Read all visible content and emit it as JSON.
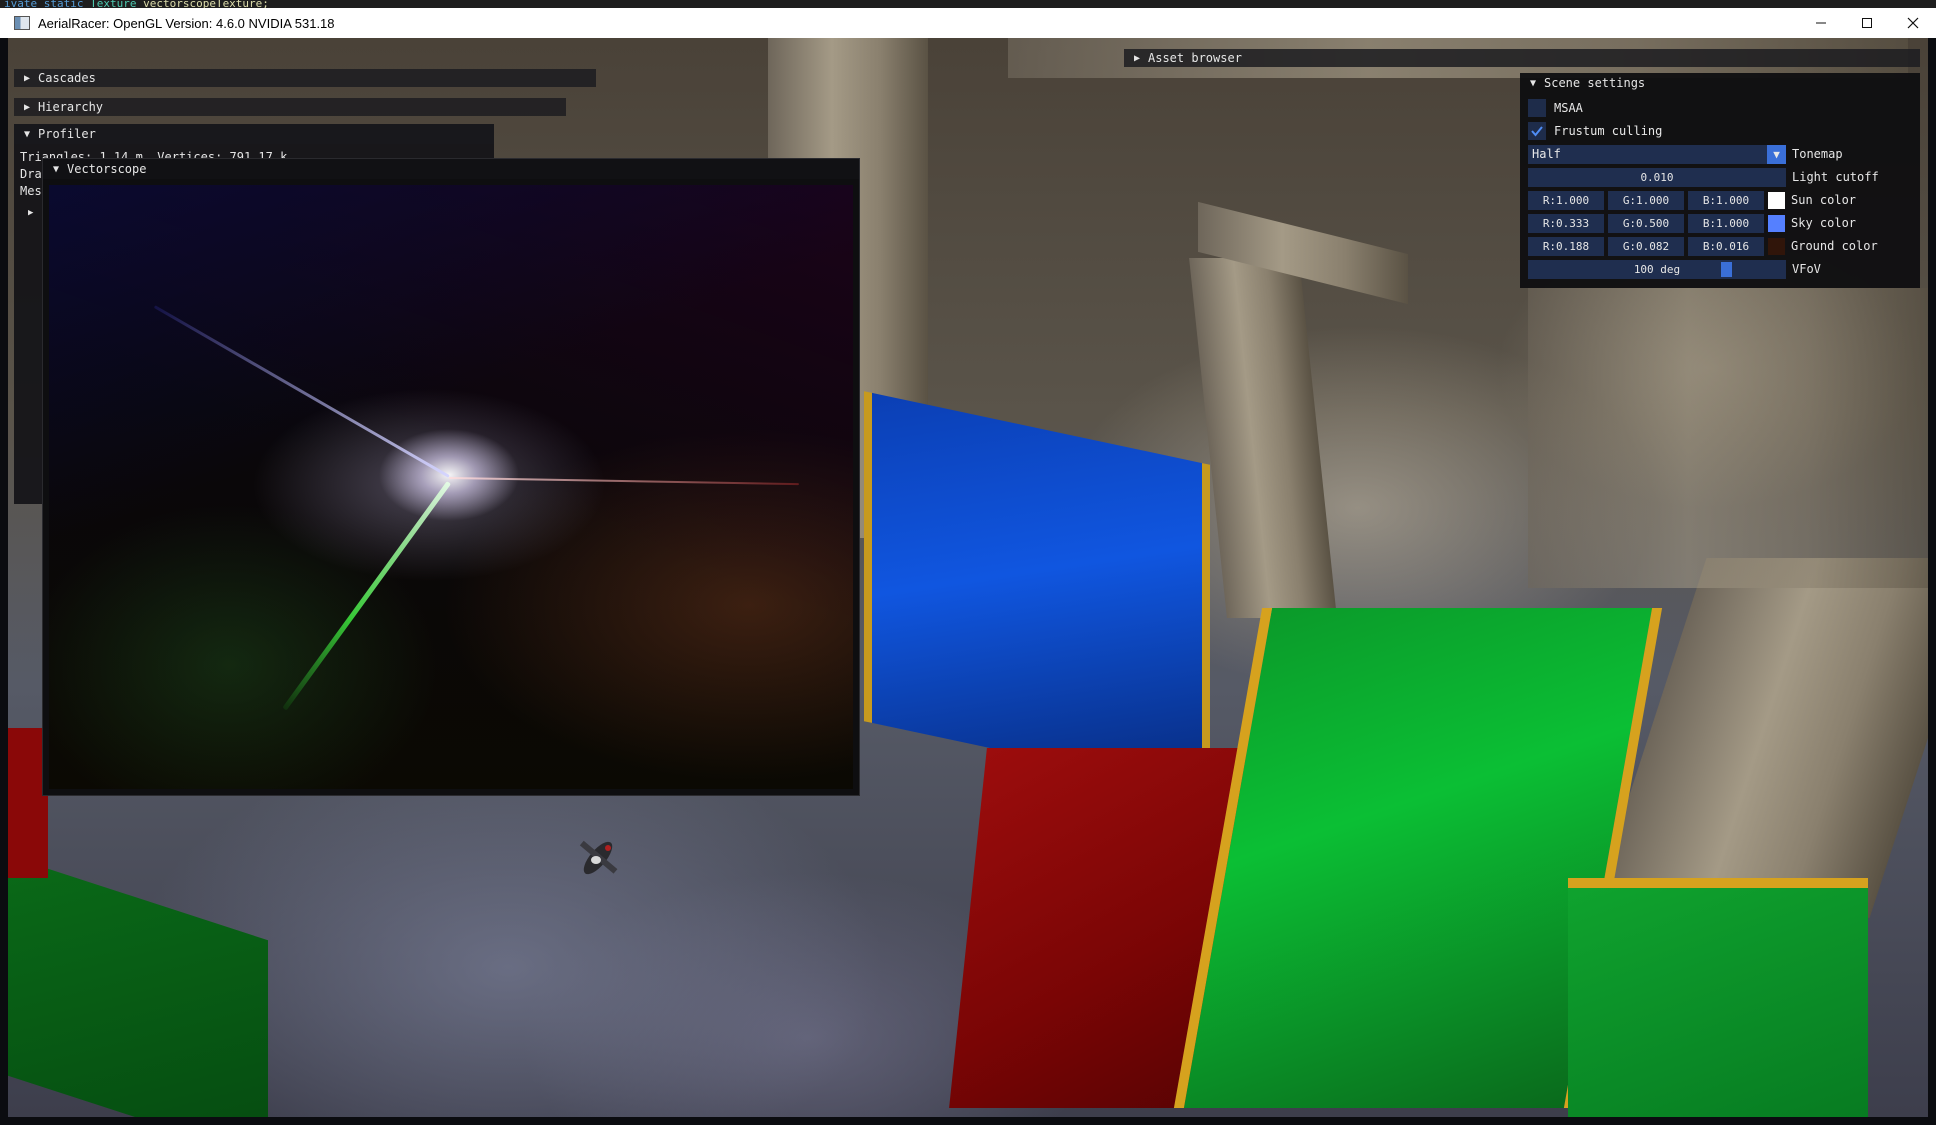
{
  "editor_text": {
    "a": "ivate static",
    "b": "Texture",
    "c": "vectorscopeTexture;"
  },
  "window": {
    "title": "AerialRacer: OpenGL Version: 4.6.0 NVIDIA 531.18",
    "minimize": "—",
    "maximize": "☐",
    "close": "✕"
  },
  "panels": {
    "cascades": "Cascades",
    "hierarchy": "Hierarchy",
    "profiler": "Profiler",
    "asset_browser": "Asset browser"
  },
  "profiler": {
    "line1": "Triangles: 1.14 m, Vertices: 791.17 k",
    "line2": "Dra",
    "line3": "Mes"
  },
  "vectorscope": {
    "title": "Vectorscope"
  },
  "scene_settings": {
    "title": "Scene settings",
    "msaa": {
      "label": "MSAA",
      "checked": false
    },
    "frustum_culling": {
      "label": "Frustum culling",
      "checked": true
    },
    "tonemap": {
      "value": "Half",
      "label": "Tonemap"
    },
    "light_cutoff": {
      "value": "0.010",
      "label": "Light cutoff"
    },
    "sun_color": {
      "r": "R:1.000",
      "g": "G:1.000",
      "b": "B:1.000",
      "label": "Sun color",
      "swatch": "#ffffff"
    },
    "sky_color": {
      "r": "R:0.333",
      "g": "G:0.500",
      "b": "B:1.000",
      "label": "Sky color",
      "swatch": "#5580ff"
    },
    "ground_color": {
      "r": "R:0.188",
      "g": "G:0.082",
      "b": "B:0.016",
      "label": "Ground color",
      "swatch": "#30150a"
    },
    "vfov": {
      "value": "100 deg",
      "label": "VFoV",
      "fraction": 0.78
    }
  },
  "colors": {
    "accent": "#3a6fd8",
    "frame_bg": "#1f2e4f"
  }
}
